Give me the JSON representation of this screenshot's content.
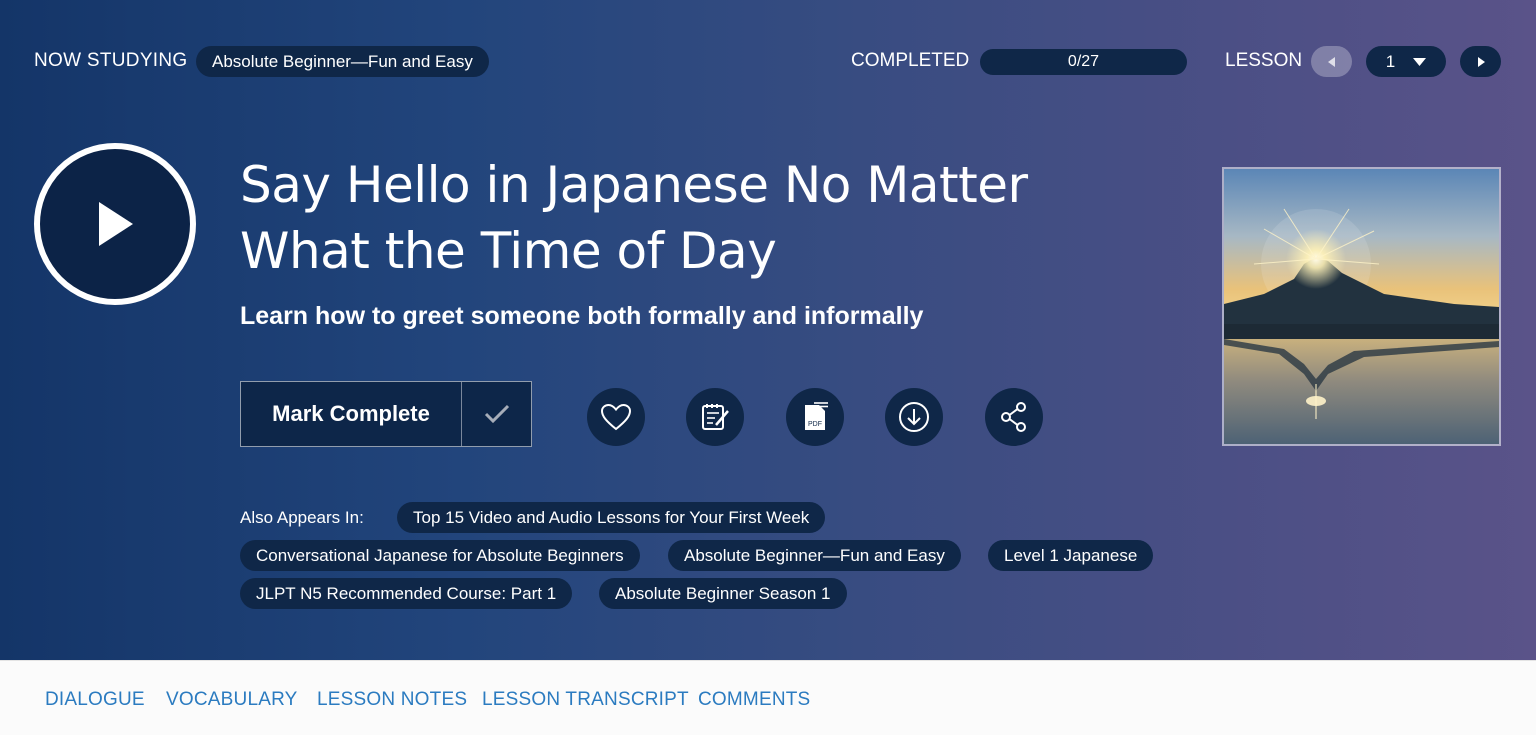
{
  "header": {
    "now_studying_label": "NOW STUDYING",
    "course_name": "Absolute Beginner—Fun and Easy",
    "completed_label": "COMPLETED",
    "progress_text": "0/27",
    "progress_fraction": 0,
    "lesson_label": "LESSON",
    "lesson_number": "1"
  },
  "lesson": {
    "title_line1": "Say Hello in Japanese No Matter",
    "title_line2": "What the Time of Day",
    "subtitle": "Learn how to greet someone both formally and informally",
    "thumbnail": "mount-fuji-sunrise-reflection"
  },
  "actions": {
    "mark_complete_label": "Mark Complete",
    "icons": [
      "heart-icon",
      "notes-icon",
      "pdf-icon",
      "download-icon",
      "share-icon"
    ]
  },
  "also_appears": {
    "label": "Also Appears In:",
    "tags": [
      "Top 15 Video and Audio Lessons for Your First Week",
      "Conversational Japanese for Absolute Beginners",
      "Absolute Beginner—Fun and Easy",
      "Level 1 Japanese",
      "JLPT N5 Recommended Course: Part 1",
      "Absolute Beginner Season 1"
    ]
  },
  "tabs": [
    "DIALOGUE",
    "VOCABULARY",
    "LESSON NOTES",
    "LESSON TRANSCRIPT",
    "COMMENTS"
  ],
  "colors": {
    "hero_start": "#143568",
    "hero_end": "#5a5389",
    "pill_bg": "#0f2748",
    "tab_text": "#2b7bc0"
  }
}
